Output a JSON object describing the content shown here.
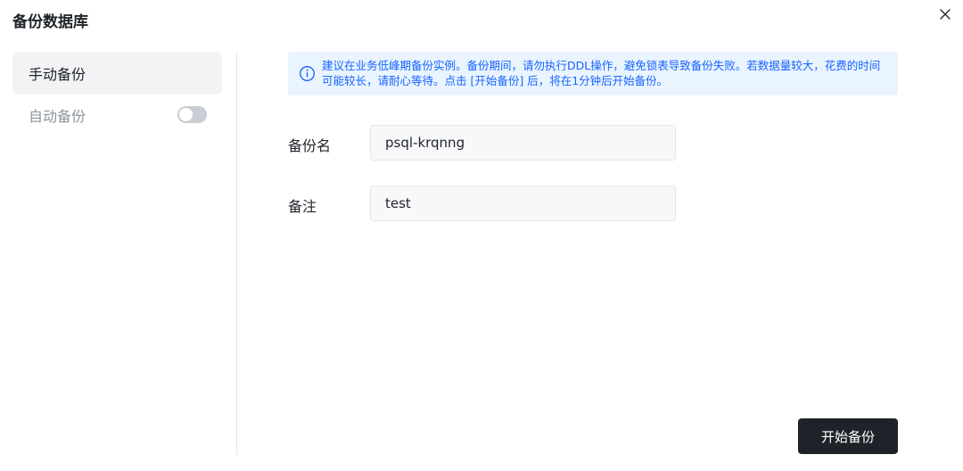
{
  "dialog": {
    "title": "备份数据库"
  },
  "icons": {
    "close": "close-icon",
    "info": "info-icon"
  },
  "sidebar": {
    "items": [
      {
        "label": "手动备份",
        "active": true
      },
      {
        "label": "自动备份",
        "active": false,
        "toggle_on": false
      }
    ]
  },
  "notice": {
    "text": "建议在业务低峰期备份实例。备份期间，请勿执行DDL操作，避免锁表导致备份失败。若数据量较大，花费的时间可能较长，请耐心等待。点击 [开始备份] 后，将在1分钟后开始备份。"
  },
  "form": {
    "backup_name": {
      "label": "备份名",
      "value": "psql-krqnng"
    },
    "note": {
      "label": "备注",
      "value": "test"
    }
  },
  "actions": {
    "start_label": "开始备份"
  },
  "colors": {
    "primary_dark": "#1f2329",
    "info_blue": "#1664ff",
    "info_bg": "#eaf4ff",
    "sidebar_active_bg": "#f2f3f5",
    "toggle_off": "#c9cdd4"
  }
}
